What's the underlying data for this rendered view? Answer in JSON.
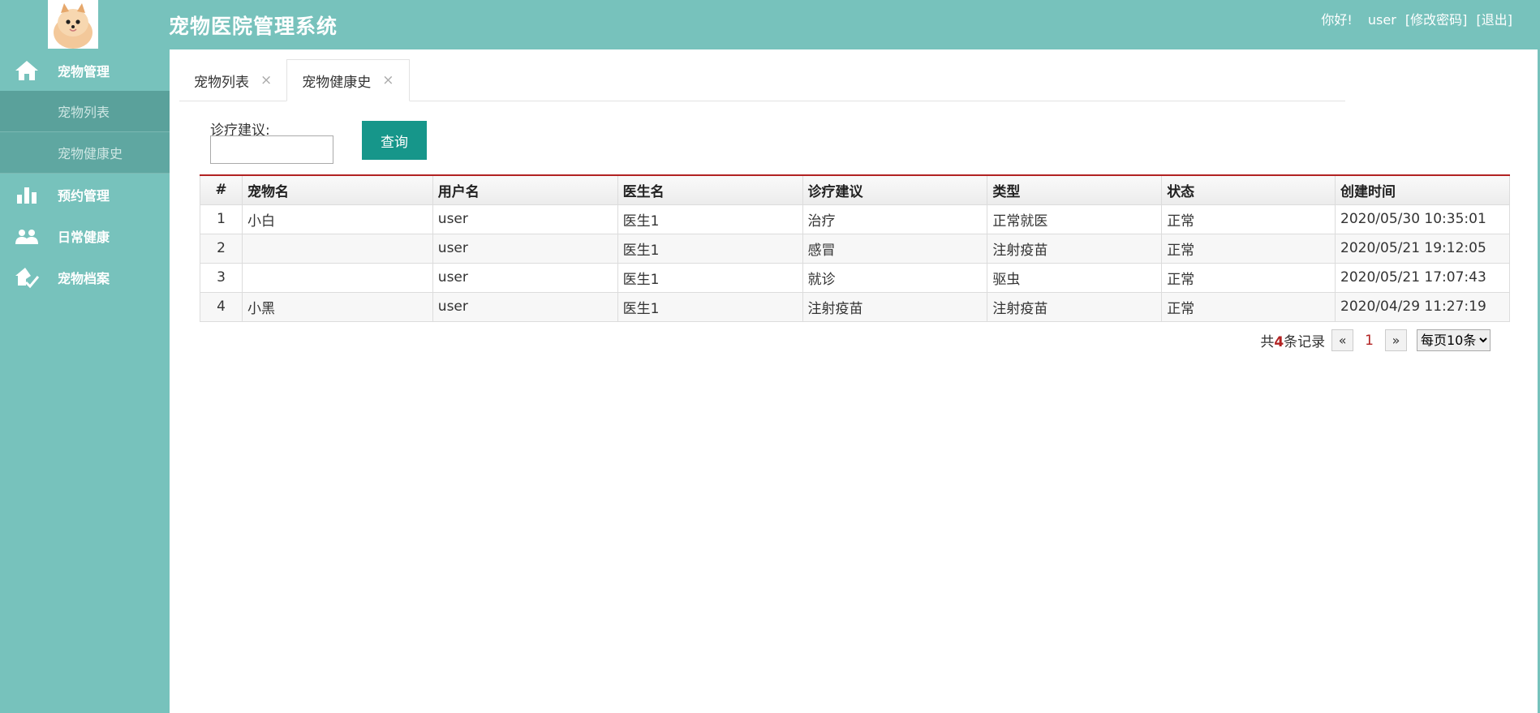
{
  "app": {
    "title": "宠物医院管理系统"
  },
  "user_bar": {
    "greeting": "你好!",
    "username": "user",
    "change_password": "[修改密码]",
    "logout": "[退出]"
  },
  "sidebar": {
    "groups": [
      {
        "label": "宠物管理",
        "icon": "home-icon"
      },
      {
        "label": "预约管理",
        "icon": "bar-chart-icon"
      },
      {
        "label": "日常健康",
        "icon": "users-icon"
      },
      {
        "label": "宠物档案",
        "icon": "house-check-icon"
      }
    ],
    "sub_items": [
      {
        "label": "宠物列表"
      },
      {
        "label": "宠物健康史"
      }
    ]
  },
  "tabs": [
    {
      "label": "宠物列表",
      "close": "×"
    },
    {
      "label": "宠物健康史",
      "close": "×"
    }
  ],
  "filter": {
    "label": "诊疗建议:",
    "value": "",
    "query_label": "查询"
  },
  "table": {
    "headers": [
      "#",
      "宠物名",
      "用户名",
      "医生名",
      "诊疗建议",
      "类型",
      "状态",
      "创建时间"
    ],
    "rows": [
      [
        "1",
        "小白",
        "user",
        "医生1",
        "治疗",
        "正常就医",
        "正常",
        "2020/05/30 10:35:01"
      ],
      [
        "2",
        "",
        "user",
        "医生1",
        "感冒",
        "注射疫苗",
        "正常",
        "2020/05/21 19:12:05"
      ],
      [
        "3",
        "",
        "user",
        "医生1",
        "就诊",
        "驱虫",
        "正常",
        "2020/05/21 17:07:43"
      ],
      [
        "4",
        "小黑",
        "user",
        "医生1",
        "注射疫苗",
        "注射疫苗",
        "正常",
        "2020/04/29 11:27:19"
      ]
    ]
  },
  "pager": {
    "total_prefix": "共",
    "total_count": "4",
    "total_suffix": "条记录",
    "prev": "«",
    "current_page": "1",
    "next": "»",
    "page_size_selected": "每页10条"
  },
  "colors": {
    "primary": "#77c2bc",
    "button": "#16968a",
    "accent_red": "#b22222"
  }
}
